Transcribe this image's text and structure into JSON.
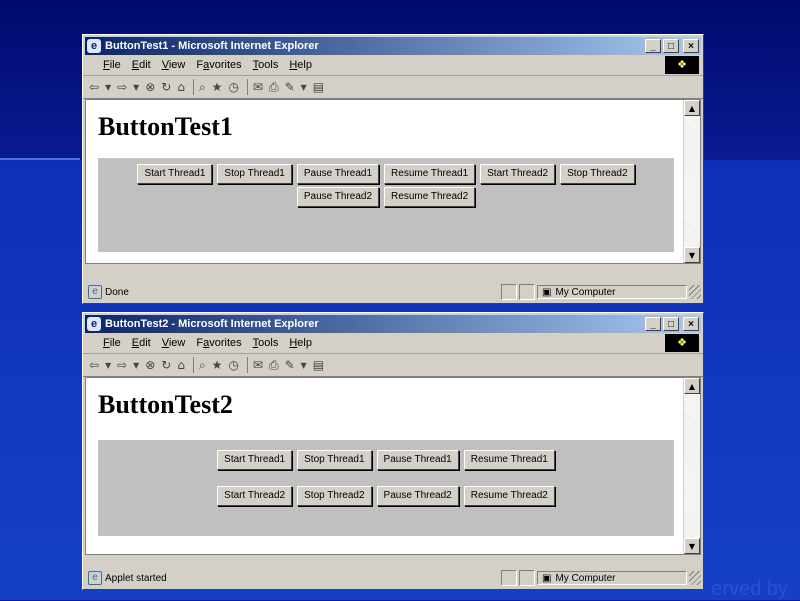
{
  "windows": [
    {
      "title": "ButtonTest1 - Microsoft Internet Explorer",
      "heading": "ButtonTest1",
      "button_rows": [
        [
          "Start Thread1",
          "Stop Thread1",
          "Pause Thread1",
          "Resume Thread1",
          "Start Thread2",
          "Stop Thread2",
          "Pause Thread2",
          "Resume Thread2"
        ]
      ],
      "status": "Done",
      "zone": "My Computer"
    },
    {
      "title": "ButtonTest2 - Microsoft Internet Explorer",
      "heading": "ButtonTest2",
      "button_rows": [
        [
          "Start Thread1",
          "Stop Thread1",
          "Pause Thread1",
          "Resume Thread1"
        ],
        [
          "Start Thread2",
          "Stop Thread2",
          "Pause Thread2",
          "Resume Thread2"
        ]
      ],
      "status": "Applet started",
      "zone": "My Computer"
    }
  ],
  "menu": [
    {
      "key": "F",
      "rest": "ile"
    },
    {
      "key": "E",
      "rest": "dit"
    },
    {
      "key": "V",
      "rest": "iew"
    },
    {
      "key": "a",
      "pre": "F",
      "rest": "vorites"
    },
    {
      "key": "T",
      "rest": "ools"
    },
    {
      "key": "H",
      "rest": "elp"
    }
  ],
  "window_controls": {
    "minimize": "_",
    "maximize": "□",
    "close": "×"
  },
  "footer_text": "erved by",
  "icons": [
    "ie-icon",
    "back-icon",
    "forward-icon",
    "stop-icon",
    "refresh-icon",
    "home-icon",
    "search-icon",
    "favorites-icon",
    "history-icon",
    "mail-icon",
    "print-icon",
    "edit-icon"
  ]
}
